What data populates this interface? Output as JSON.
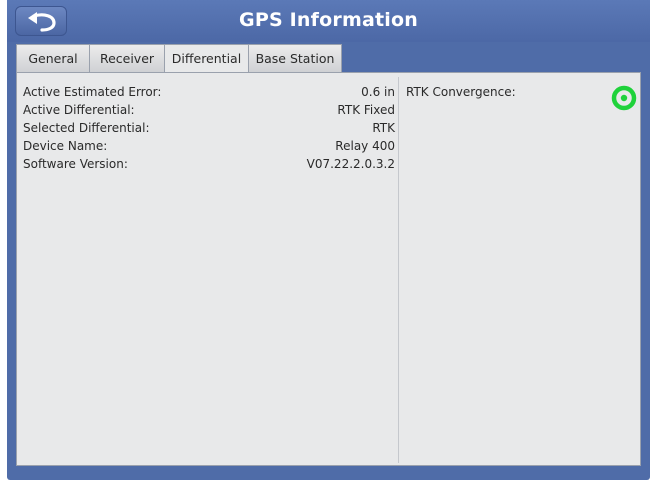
{
  "window": {
    "title": "GPS Information",
    "back_icon": "back-arrow-icon"
  },
  "tabs": [
    {
      "label": "General",
      "active": false
    },
    {
      "label": "Receiver",
      "active": false
    },
    {
      "label": "Differential",
      "active": true
    },
    {
      "label": "Base Station",
      "active": false
    }
  ],
  "differential": {
    "rows": [
      {
        "label": "Active Estimated Error:",
        "value": "0.6 in"
      },
      {
        "label": "Active Differential:",
        "value": "RTK Fixed"
      },
      {
        "label": "Selected Differential:",
        "value": "RTK"
      },
      {
        "label": "Device Name:",
        "value": "Relay 400"
      },
      {
        "label": "Software Version:",
        "value": "V07.22.2.0.3.2"
      }
    ],
    "rtk_convergence": {
      "label": "RTK Convergence:",
      "indicator_icon": "green-ring-icon",
      "indicator_color": "#1fd23b"
    }
  },
  "colors": {
    "title_bar": "#4f6ca8",
    "panel_bg": "#e8e9ea"
  }
}
